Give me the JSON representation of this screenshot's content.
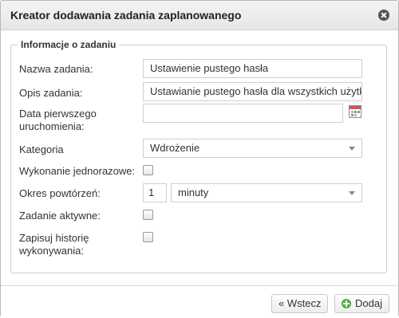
{
  "dialog": {
    "title": "Kreator dodawania zadania zaplanowanego"
  },
  "section": {
    "legend": "Informacje o zadaniu"
  },
  "fields": {
    "name_label": "Nazwa zadania:",
    "name_value": "Ustawienie pustego hasła",
    "description_label": "Opis zadania:",
    "description_value": "Ustawianie pustego hasła dla wszystkich użytk",
    "first_run_label_line1": "Data pierwszego",
    "first_run_label_line2": "uruchomienia:",
    "first_run_value": "",
    "category_label": "Kategoria",
    "category_value": "Wdrożenie",
    "one_time_label": "Wykonanie jednorazowe:",
    "repeat_label": "Okres powtórzeń:",
    "repeat_value": "1",
    "repeat_unit": "minuty",
    "active_label": "Zadanie aktywne:",
    "history_label_line1": "Zapisuj historię",
    "history_label_line2": "wykonywania:"
  },
  "checkboxes": {
    "one_time": false,
    "active": false,
    "history": false
  },
  "footer": {
    "back_label": "« Wstecz",
    "add_label": "Dodaj"
  },
  "colors": {
    "add_icon": "#4caf3f",
    "titlebar": "#eeeeee"
  }
}
